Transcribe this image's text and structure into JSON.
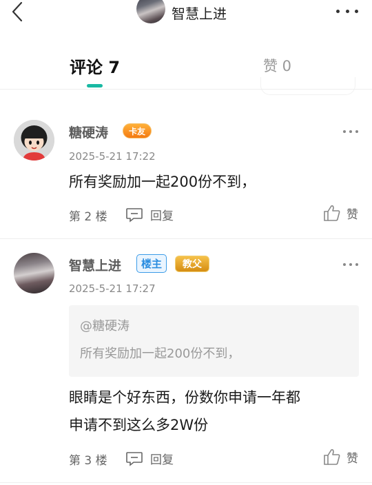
{
  "header": {
    "title": "智慧上进",
    "back_icon": "chevron-left-icon",
    "more_icon": "more-dots-icon"
  },
  "tabs": [
    {
      "label": "评论 7",
      "active": true
    },
    {
      "label": "赞 0",
      "active": false
    }
  ],
  "accent_color": "#19b9a3",
  "comments": [
    {
      "user": "糖硬涛",
      "badges": [
        "卡友"
      ],
      "time": "2025-5-21 17:22",
      "text": "所有奖励加一起200份不到，",
      "floor": "第 2 楼",
      "reply_label": "回复",
      "like_label": "赞"
    },
    {
      "user": "智慧上进",
      "badges": [
        "楼主",
        "教父"
      ],
      "time": "2025-5-21 17:27",
      "quote": {
        "user": "@糖硬涛",
        "text": "所有奖励加一起200份不到，"
      },
      "text_lines": [
        "眼睛是个好东西，份数你申请一年都",
        "申请不到这么多2W份"
      ],
      "floor": "第 3 楼",
      "reply_label": "回复",
      "like_label": "赞"
    }
  ]
}
